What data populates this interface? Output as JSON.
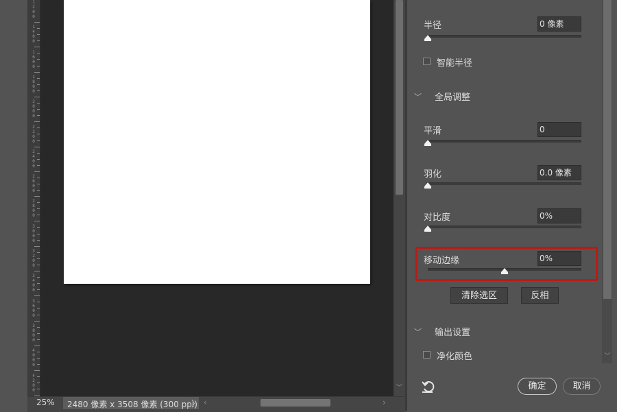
{
  "ruler": {
    "labels": [
      "1\n2\n0\n0",
      "1\n4\n0\n0",
      "1\n6\n0\n0",
      "1\n8\n0\n0",
      "2\n0\n0\n0",
      "2\n2\n0\n0",
      "2\n4\n0\n0",
      "2\n6\n0\n0",
      "2\n8\n0\n0",
      "3\n0\n0\n0",
      "3\n2\n0\n0",
      "3\n4\n0\n0",
      "3\n6\n0\n0",
      "3\n8\n0\n0",
      "4\n0\n0\n0",
      "4\n2\n0\n0"
    ]
  },
  "status": {
    "zoom": "25%",
    "doc_info": "2480 像素 x 3508 像素 (300 ppi)",
    "doc_info_arrow": "〉",
    "scroll_left": "‹",
    "scroll_right": "›"
  },
  "panel": {
    "radius": {
      "label": "半径",
      "value": "0 像素",
      "slider": 0.0
    },
    "smart_radius": {
      "label": "智能半径",
      "checked": false
    },
    "global_section": {
      "label": "全局调整",
      "chevron": "﹀"
    },
    "smooth": {
      "label": "平滑",
      "value": "0",
      "slider": 0.0
    },
    "feather": {
      "label": "羽化",
      "value": "0.0 像素",
      "slider": 0.0
    },
    "contrast": {
      "label": "对比度",
      "value": "0%",
      "slider": 0.0
    },
    "shift_edge": {
      "label": "移动边缘",
      "value": "0%",
      "slider": 0.5
    },
    "clear_selection_button": "清除选区",
    "invert_button": "反相",
    "output_section": {
      "label": "输出设置",
      "chevron": "﹀"
    },
    "decontaminate": {
      "label": "净化颜色",
      "checked": false
    },
    "ok_button": "确定",
    "cancel_button": "取消"
  },
  "colors": {
    "highlight": "#b81c14",
    "canvas_bg": "#282828",
    "panel_bg": "#535353"
  }
}
